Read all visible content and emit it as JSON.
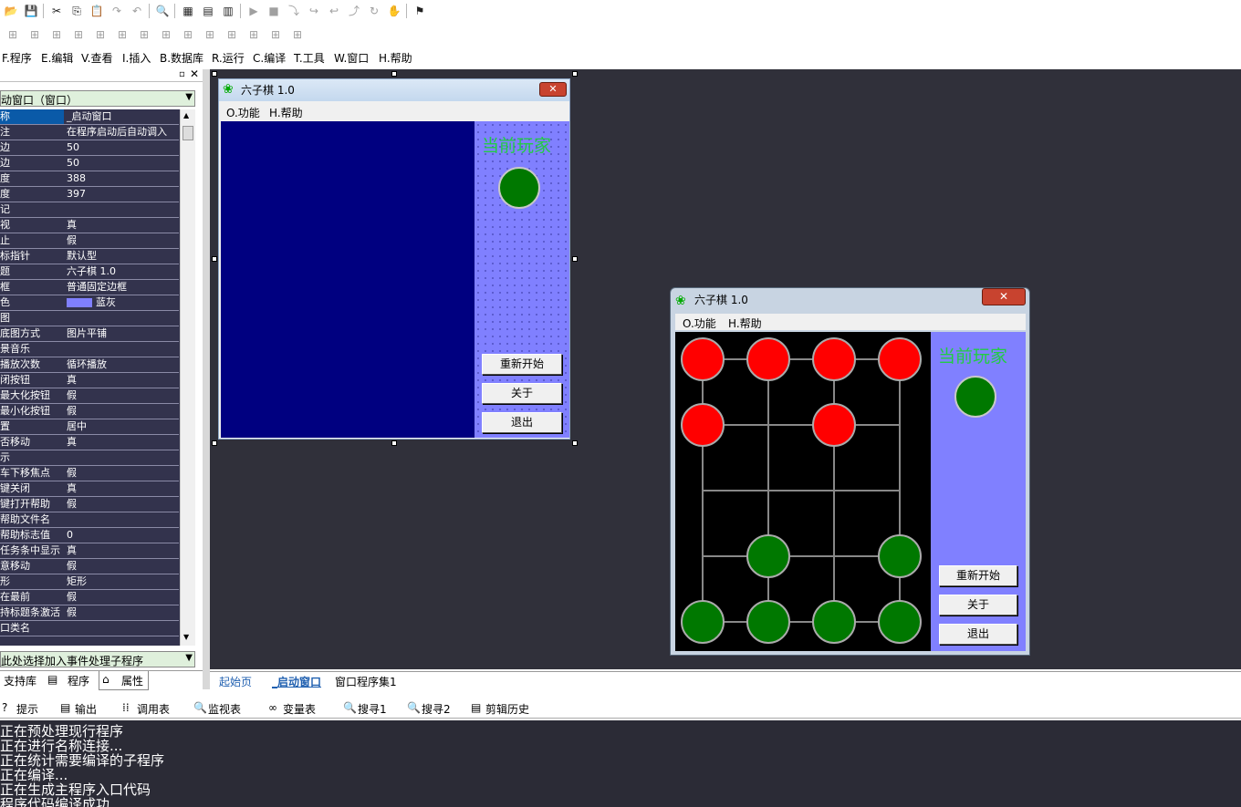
{
  "toolbar1_icons": [
    "open-icon",
    "save-icon",
    "cut-icon",
    "copy-icon",
    "paste-icon",
    "redo-icon",
    "undo-icon",
    "find-icon",
    "layout1-icon",
    "layout2-icon",
    "layout3-icon",
    "run-icon",
    "stop-icon",
    "step1-icon",
    "step2-icon",
    "step3-icon",
    "step4-icon",
    "step5-icon",
    "hand-icon",
    "debug-icon"
  ],
  "menu": [
    "F.程序",
    "E.编辑",
    "V.查看",
    "I.插入",
    "B.数据库",
    "R.运行",
    "C.编译",
    "T.工具",
    "W.窗口",
    "H.帮助"
  ],
  "left_panel": {
    "object_select": "动窗口（窗口）",
    "properties": [
      {
        "name": "称",
        "value": "_启动窗口"
      },
      {
        "name": "注",
        "value": "在程序启动后自动调入"
      },
      {
        "name": "边",
        "value": "50"
      },
      {
        "name": "边",
        "value": "50"
      },
      {
        "name": "度",
        "value": "388"
      },
      {
        "name": "度",
        "value": "397"
      },
      {
        "name": "记",
        "value": ""
      },
      {
        "name": "视",
        "value": "真"
      },
      {
        "name": "止",
        "value": "假"
      },
      {
        "name": "标指针",
        "value": "默认型"
      },
      {
        "name": "题",
        "value": "六子棋 1.0"
      },
      {
        "name": "框",
        "value": "普通固定边框"
      },
      {
        "name": "色",
        "value": "蓝灰"
      },
      {
        "name": "图",
        "value": ""
      },
      {
        "name": "底图方式",
        "value": "图片平铺"
      },
      {
        "name": "景音乐",
        "value": ""
      },
      {
        "name": "播放次数",
        "value": "循环播放"
      },
      {
        "name": "闭按钮",
        "value": "真"
      },
      {
        "name": "最大化按钮",
        "value": "假"
      },
      {
        "name": "最小化按钮",
        "value": "假"
      },
      {
        "name": "置",
        "value": "居中"
      },
      {
        "name": "否移动",
        "value": "真"
      },
      {
        "name": "示",
        "value": ""
      },
      {
        "name": "车下移焦点",
        "value": "假"
      },
      {
        "name": "键关闭",
        "value": "真"
      },
      {
        "name": "键打开帮助",
        "value": "假"
      },
      {
        "name": "帮助文件名",
        "value": ""
      },
      {
        "name": "帮助标志值",
        "value": "0"
      },
      {
        "name": "任务条中显示",
        "value": "真"
      },
      {
        "name": "意移动",
        "value": "假"
      },
      {
        "name": "形",
        "value": "矩形"
      },
      {
        "name": "在最前",
        "value": "假"
      },
      {
        "name": "持标题条激活",
        "value": "假"
      },
      {
        "name": "口类名",
        "value": ""
      }
    ],
    "event_select": "此处选择加入事件处理子程序",
    "tabs": [
      "支持库",
      "程序",
      "属性"
    ]
  },
  "design_window": {
    "title": "六子棋 1.0",
    "menu": [
      "O.功能",
      "H.帮助"
    ],
    "current_player_label": "当前玩家",
    "buttons": [
      "重新开始",
      "关于",
      "退出"
    ]
  },
  "running_window": {
    "title": "六子棋 1.0",
    "menu": [
      "O.功能",
      "H.帮助"
    ],
    "current_player_label": "当前玩家",
    "buttons": [
      "重新开始",
      "关于",
      "退出"
    ],
    "board": {
      "red": [
        [
          0,
          0
        ],
        [
          1,
          0
        ],
        [
          2,
          0
        ],
        [
          3,
          0
        ],
        [
          0,
          1
        ],
        [
          2,
          1
        ]
      ],
      "green": [
        [
          1,
          3
        ],
        [
          3,
          3
        ],
        [
          0,
          4
        ],
        [
          1,
          4
        ],
        [
          2,
          4
        ],
        [
          3,
          4
        ]
      ]
    }
  },
  "editor_tabs": [
    "起始页",
    "_启动窗口",
    "窗口程序集1"
  ],
  "bottom_tabs": [
    "提示",
    "输出",
    "调用表",
    "监视表",
    "变量表",
    "搜寻1",
    "搜寻2",
    "剪辑历史"
  ],
  "output_lines": [
    "正在预处理现行程序",
    "正在进行名称连接...",
    "正在统计需要编译的子程序",
    "正在编译...",
    "正在生成主程序入口代码",
    "程序代码编译成功"
  ],
  "colors": {
    "board_blue": "#000080",
    "panel_blue": "#8080ff",
    "red_piece": "#ff0000",
    "green_piece": "#007800",
    "label_green": "#22cc44"
  }
}
